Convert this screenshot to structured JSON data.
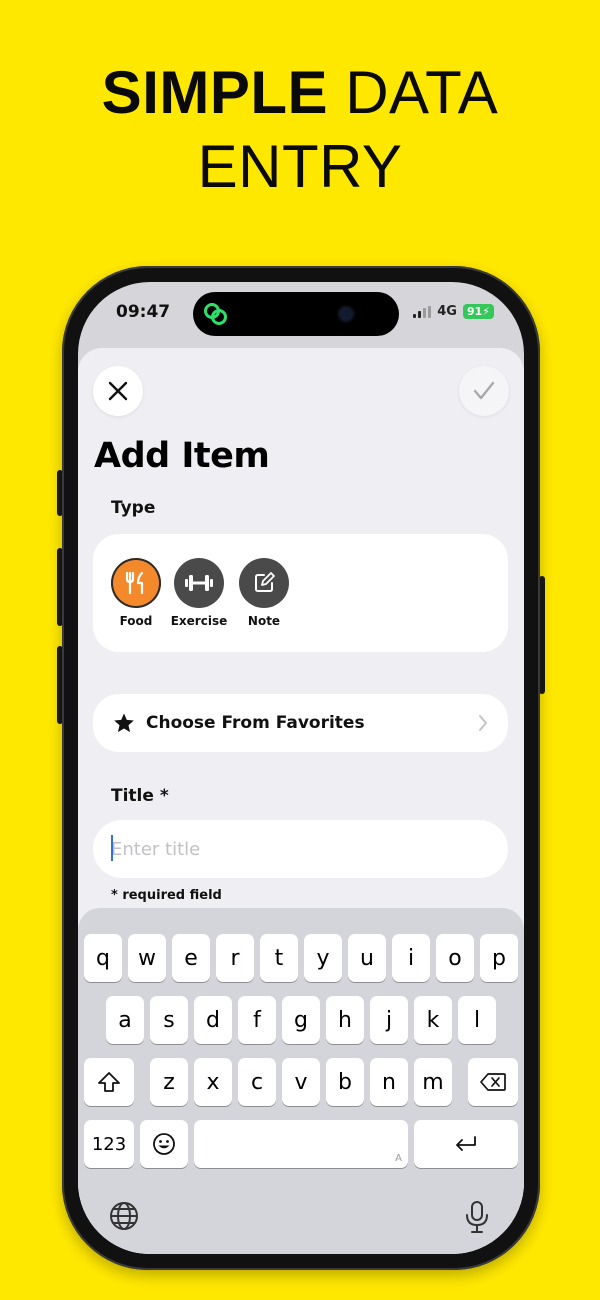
{
  "headline": {
    "bold": "SIMPLE",
    "light_1": "DATA",
    "line_2": "ENTRY"
  },
  "status": {
    "time": "09:47",
    "network": "4G",
    "battery": "91"
  },
  "sheet": {
    "title": "Add Item",
    "type_label": "Type",
    "types": [
      {
        "label": "Food",
        "icon": "fork-knife-icon",
        "selected": true
      },
      {
        "label": "Exercise",
        "icon": "dumbbell-icon",
        "selected": false
      },
      {
        "label": "Note",
        "icon": "edit-note-icon",
        "selected": false
      }
    ],
    "favorites_label": "Choose From Favorites",
    "title_label": "Title *",
    "title_placeholder": "Enter title",
    "title_value": "",
    "required_note": "* required field"
  },
  "keyboard": {
    "row1": [
      "q",
      "w",
      "e",
      "r",
      "t",
      "y",
      "u",
      "i",
      "o",
      "p"
    ],
    "row2": [
      "a",
      "s",
      "d",
      "f",
      "g",
      "h",
      "j",
      "k",
      "l"
    ],
    "row3": [
      "z",
      "x",
      "c",
      "v",
      "b",
      "n",
      "m"
    ],
    "numbers_label": "123",
    "space_hint": "A"
  },
  "colors": {
    "background": "#FFE800",
    "food_accent": "#F4892C",
    "battery": "#35C759",
    "caret": "#2F6FE0"
  }
}
